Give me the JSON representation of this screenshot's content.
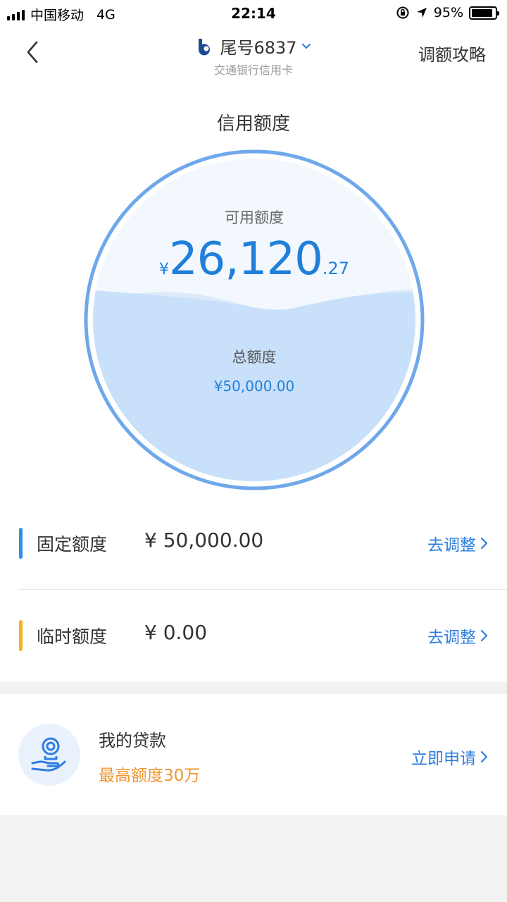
{
  "status_bar": {
    "carrier": "中国移动",
    "network": "4G",
    "time": "22:14",
    "battery_percent": "95%",
    "battery_level": 0.95
  },
  "nav": {
    "card_title": "尾号6837",
    "card_subtitle": "交通银行信用卡",
    "strategy_label": "调额攻略"
  },
  "credit": {
    "title": "信用额度",
    "available_label": "可用额度",
    "currency_symbol": "¥",
    "available_int": "26,120",
    "available_dec": ".27",
    "total_label": "总额度",
    "total_value": "¥50,000.00",
    "available_ratio": 0.5224
  },
  "limits": [
    {
      "label": "固定额度",
      "amount": "¥ 50,000.00",
      "action": "去调整",
      "color": "#2f8ef0"
    },
    {
      "label": "临时额度",
      "amount": "¥ 0.00",
      "action": "去调整",
      "color": "#f5b21b"
    }
  ],
  "loan": {
    "title": "我的贷款",
    "subtitle": "最高额度30万",
    "action": "立即申请",
    "icon": "loan-hand-coin-icon"
  },
  "colors": {
    "accent": "#2f7de1",
    "amount_blue": "#1f7fd9",
    "orange": "#f0962e"
  }
}
